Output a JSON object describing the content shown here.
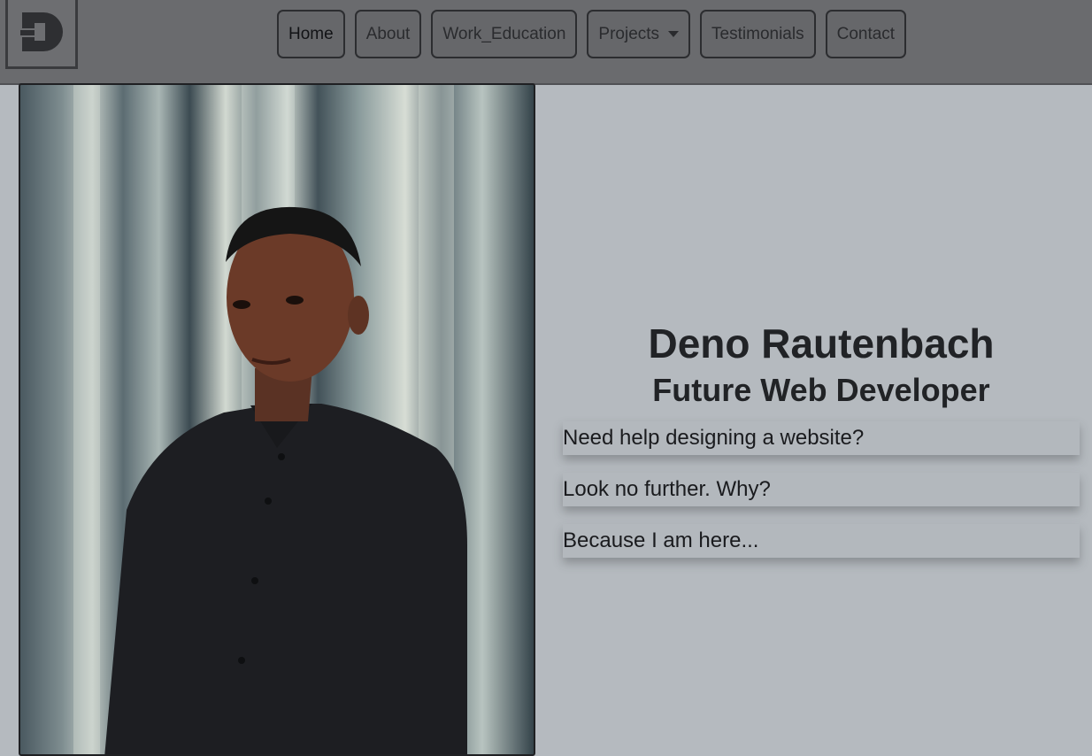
{
  "nav": {
    "logo_letter": "D",
    "items": [
      {
        "label": "Home",
        "active": true
      },
      {
        "label": "About"
      },
      {
        "label": "Work_Education"
      },
      {
        "label": "Projects",
        "dropdown": true
      },
      {
        "label": "Testimonials"
      },
      {
        "label": "Contact"
      }
    ]
  },
  "hero": {
    "name": "Deno Rautenbach",
    "role": "Future Web Developer",
    "lines": [
      "Need help designing a website?",
      "Look no further. Why?",
      "Because I am here..."
    ]
  },
  "colors": {
    "background": "#b5babf",
    "navbar": "#6a6b6e",
    "text": "#212326"
  }
}
